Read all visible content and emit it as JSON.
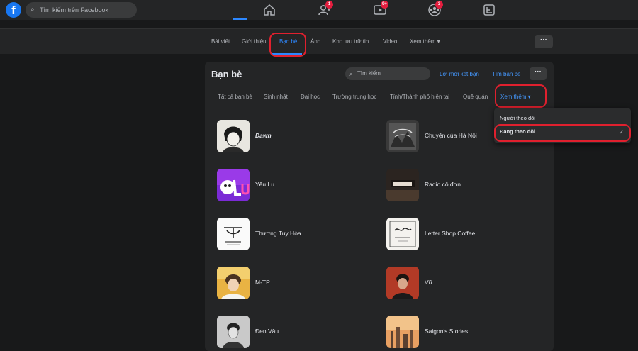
{
  "topbar": {
    "logo_letter": "f",
    "search_placeholder": "Tìm kiếm trên Facebook",
    "badges": {
      "friends": "1",
      "watch": "9+",
      "groups": "3"
    }
  },
  "profile_tabs": [
    "Bài viết",
    "Giới thiệu",
    "Bạn bè",
    "Ảnh",
    "Kho lưu trữ tin",
    "Video",
    "Xem thêm ▾"
  ],
  "profile_more": "···",
  "friends_panel": {
    "title": "Bạn bè",
    "search_placeholder": "Tìm kiếm",
    "friend_requests": "Lời mời kết bạn",
    "find_friends": "Tìm bạn bè",
    "more": "···",
    "filter_tabs": [
      "Tất cả bạn bè",
      "Sinh nhật",
      "Đại học",
      "Trường trung học",
      "Tỉnh/Thành phố hiện tại",
      "Quê quán",
      "Xem thêm ▾"
    ],
    "friends": [
      {
        "name": "Dawn"
      },
      {
        "name": "Chuyện của Hà Nội"
      },
      {
        "name": "Yêu Lu"
      },
      {
        "name": "Radio cô đơn"
      },
      {
        "name": "Thương Tuy Hòa"
      },
      {
        "name": "Letter Shop Coffee"
      },
      {
        "name": "M-TP"
      },
      {
        "name": "Vũ."
      },
      {
        "name": "Đen Vâu"
      },
      {
        "name": "Saigon's Stories"
      }
    ]
  },
  "dropdown": {
    "items": [
      "Người theo dõi",
      "Đang theo dõi"
    ],
    "selected": "Đang theo dõi"
  },
  "colors": {
    "accent": "#2d88ff",
    "highlight_oval": "#e0202e",
    "bg": "#18191a",
    "surface": "#242526"
  }
}
